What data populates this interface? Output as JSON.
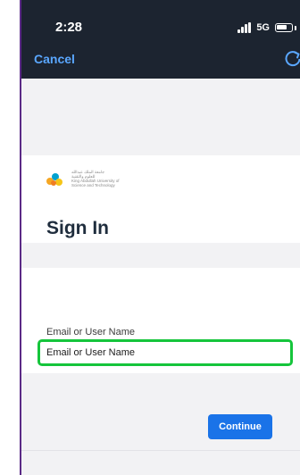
{
  "status_bar": {
    "time": "2:28",
    "network": "5G"
  },
  "nav": {
    "cancel_label": "Cancel",
    "refresh_icon": "refresh-icon"
  },
  "brand": {
    "logo_icon": "kaust-logo",
    "logo_text_lines": [
      "جامعة الملك عبدالله",
      "للعلوم والتقنية",
      "King Abdullah University of",
      "Science and Technology"
    ]
  },
  "form": {
    "title": "Sign In",
    "username_label": "Email or User Name",
    "username_placeholder": "Email or User Name",
    "username_value": ""
  },
  "actions": {
    "continue_label": "Continue"
  },
  "colors": {
    "topbar": "#1c2430",
    "link": "#5aa7ff",
    "primary_button": "#1a73e8",
    "highlight": "#15c53b",
    "title_text": "#1f2d3d",
    "background": "#f2f2f4"
  }
}
